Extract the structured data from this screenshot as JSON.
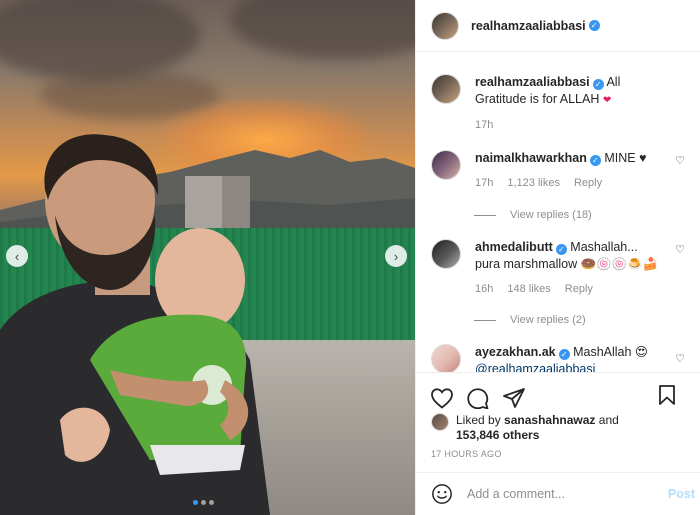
{
  "post": {
    "author": "realhamzaaliabbasi",
    "verified_mark": "✓",
    "caption": "All Gratitude is for ALLAH",
    "caption_time": "17h",
    "carousel": {
      "slide_count": 3,
      "active_index": 0,
      "prev_arrow": "‹",
      "next_arrow": "›"
    }
  },
  "comments": [
    {
      "user": "naimalkhawarkhan",
      "text": "MINE ♥",
      "time": "17h",
      "likes": "1,123 likes",
      "reply": "Reply",
      "view_replies": "View replies (18)"
    },
    {
      "user": "ahmedalibutt",
      "text": "Mashallah... pura marshmallow 🍩🍥🍥🍮🍰",
      "time": "16h",
      "likes": "148 likes",
      "reply": "Reply",
      "view_replies": "View replies (2)"
    },
    {
      "user": "ayezakhan.ak",
      "text": "MashAllah 😍",
      "mention": "@realhamzaaliabbasi"
    }
  ],
  "actions": {
    "icons": [
      "heart-icon",
      "comment-icon",
      "share-icon",
      "bookmark-icon"
    ],
    "liked_by_prefix": "Liked by",
    "liked_by_user": "sanashahnawaz",
    "liked_by_suffix": "and",
    "others": "153,846 others",
    "timestamp": "17 HOURS AGO"
  },
  "add_comment": {
    "placeholder": "Add a comment...",
    "post_label": "Post"
  },
  "colors": {
    "accent": "#3897f0",
    "post_disabled": "#b2dffc",
    "muted": "#8e8e8e",
    "text": "#262626"
  }
}
